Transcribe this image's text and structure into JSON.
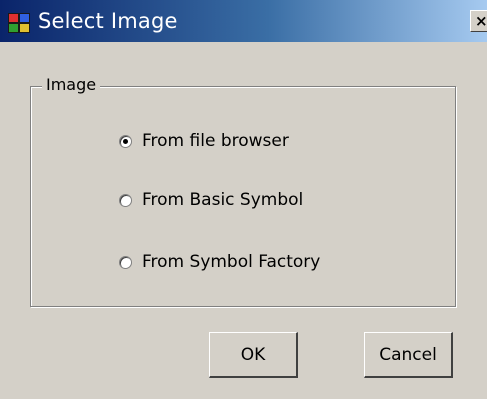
{
  "window": {
    "title": "Select Image",
    "close_glyph": "×",
    "icon": "app-icon"
  },
  "group": {
    "label": "Image",
    "options": [
      {
        "label": "From file browser",
        "checked": true
      },
      {
        "label": "From Basic Symbol",
        "checked": false
      },
      {
        "label": "From Symbol Factory",
        "checked": false
      }
    ]
  },
  "buttons": {
    "ok": "OK",
    "cancel": "Cancel"
  },
  "colors": {
    "face": "#d4d0c8",
    "title_start": "#0a246a",
    "title_end": "#a6caf0"
  }
}
